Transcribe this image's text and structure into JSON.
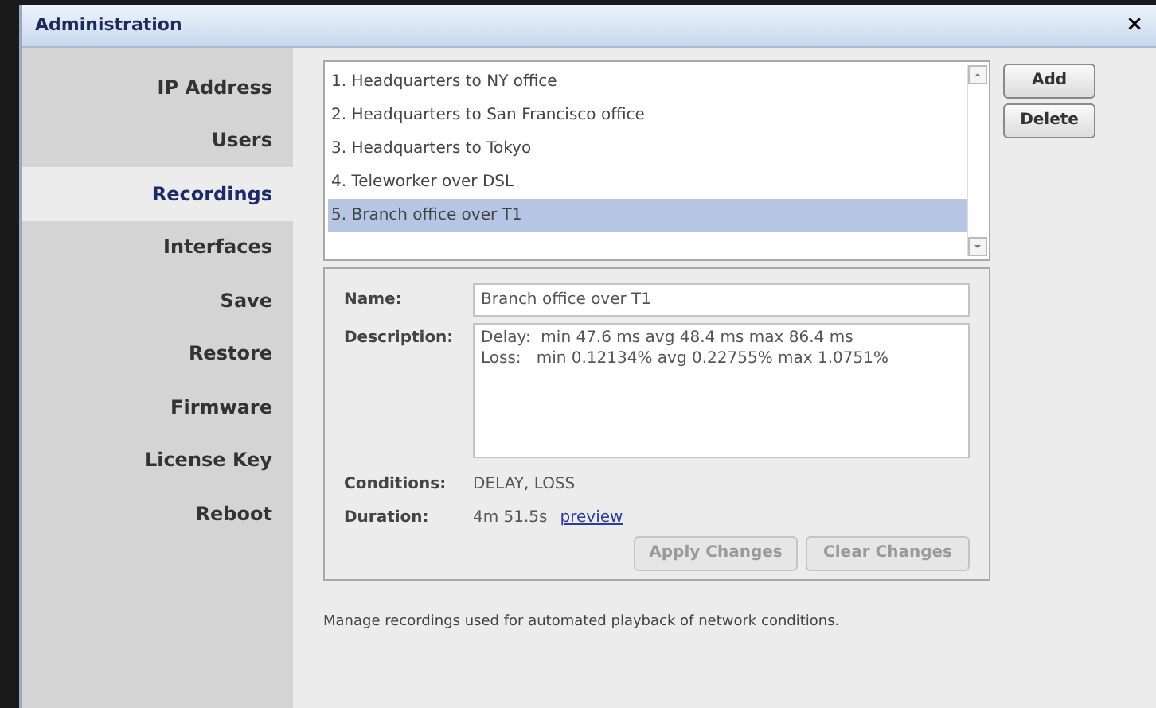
{
  "window": {
    "title": "Administration",
    "close": "×"
  },
  "sidebar": {
    "items": [
      {
        "label": "IP Address",
        "selected": false
      },
      {
        "label": "Users",
        "selected": false
      },
      {
        "label": "Recordings",
        "selected": true
      },
      {
        "label": "Interfaces",
        "selected": false
      },
      {
        "label": "Save",
        "selected": false
      },
      {
        "label": "Restore",
        "selected": false
      },
      {
        "label": "Firmware",
        "selected": false
      },
      {
        "label": "License Key",
        "selected": false
      },
      {
        "label": "Reboot",
        "selected": false
      }
    ]
  },
  "recordings": [
    {
      "label": "1. Headquarters to NY office",
      "selected": false
    },
    {
      "label": "2. Headquarters to San Francisco office",
      "selected": false
    },
    {
      "label": "3. Headquarters to Tokyo",
      "selected": false
    },
    {
      "label": "4. Teleworker over DSL",
      "selected": false
    },
    {
      "label": "5. Branch office over T1",
      "selected": true
    }
  ],
  "list_buttons": [
    {
      "label": "Add",
      "disabled": false
    },
    {
      "label": "Delete",
      "disabled": false
    }
  ],
  "details": {
    "name": {
      "label": "Name:",
      "value": "Branch office over T1"
    },
    "description": {
      "label": "Description:",
      "lines": [
        "Delay:  min 47.6 ms avg 48.4 ms max 86.4 ms",
        "Loss:   min 0.12134% avg 0.22755% max 1.0751%"
      ]
    },
    "conditions": {
      "label": "Conditions:",
      "value": "DELAY, LOSS"
    },
    "duration": {
      "label": "Duration:",
      "value": "4m 51.5s",
      "link": "preview"
    },
    "buttons": [
      {
        "label": "Apply Changes",
        "disabled": true
      },
      {
        "label": "Clear Changes",
        "disabled": true
      }
    ]
  },
  "footer": "Manage recordings used for automated playback of network conditions."
}
